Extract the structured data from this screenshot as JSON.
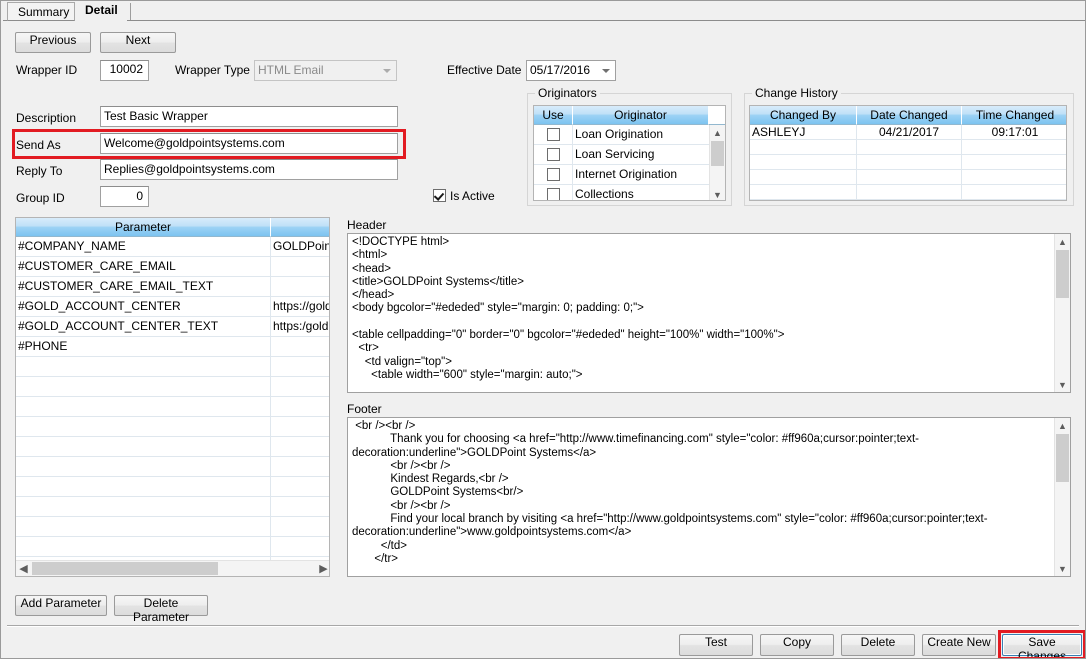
{
  "tabs": [
    {
      "label": "Summary",
      "active": false
    },
    {
      "label": "Detail",
      "active": true
    }
  ],
  "nav": {
    "previous_label": "Previous",
    "next_label": "Next"
  },
  "fields": {
    "wrapper_id_label": "Wrapper ID",
    "wrapper_id_value": "10002",
    "wrapper_type_label": "Wrapper Type",
    "wrapper_type_value": "HTML Email",
    "effective_date_label": "Effective Date",
    "effective_date_value": "05/17/2016",
    "description_label": "Description",
    "description_value": "Test Basic Wrapper",
    "send_as_label": "Send As",
    "send_as_value": "Welcome@goldpointsystems.com",
    "reply_to_label": "Reply To",
    "reply_to_value": "Replies@goldpointsystems.com",
    "group_id_label": "Group ID",
    "group_id_value": "0",
    "is_active_label": "Is Active",
    "is_active_checked": true
  },
  "originators": {
    "title": "Originators",
    "columns": [
      "Use",
      "Originator",
      ""
    ],
    "rows": [
      {
        "use": false,
        "name": "Loan Origination"
      },
      {
        "use": false,
        "name": "Loan Servicing"
      },
      {
        "use": false,
        "name": "Internet Origination"
      },
      {
        "use": false,
        "name": "Collections"
      }
    ]
  },
  "change_history": {
    "title": "Change History",
    "columns": [
      "Changed By",
      "Date Changed",
      "Time Changed"
    ],
    "rows": [
      {
        "changed_by": "ASHLEYJ",
        "date_changed": "04/21/2017",
        "time_changed": "09:17:01"
      },
      {
        "changed_by": "",
        "date_changed": "",
        "time_changed": ""
      },
      {
        "changed_by": "",
        "date_changed": "",
        "time_changed": ""
      },
      {
        "changed_by": "",
        "date_changed": "",
        "time_changed": ""
      },
      {
        "changed_by": "",
        "date_changed": "",
        "time_changed": ""
      }
    ]
  },
  "parameters": {
    "columns": [
      "Parameter",
      ""
    ],
    "rows": [
      {
        "parameter": "#COMPANY_NAME",
        "value": "GOLDPoint"
      },
      {
        "parameter": "#CUSTOMER_CARE_EMAIL",
        "value": ""
      },
      {
        "parameter": "#CUSTOMER_CARE_EMAIL_TEXT",
        "value": ""
      },
      {
        "parameter": "#GOLD_ACCOUNT_CENTER",
        "value": "https://gold"
      },
      {
        "parameter": "#GOLD_ACCOUNT_CENTER_TEXT",
        "value": "https:/goldp"
      },
      {
        "parameter": "#PHONE",
        "value": ""
      },
      {
        "parameter": "",
        "value": ""
      },
      {
        "parameter": "",
        "value": ""
      },
      {
        "parameter": "",
        "value": ""
      },
      {
        "parameter": "",
        "value": ""
      },
      {
        "parameter": "",
        "value": ""
      },
      {
        "parameter": "",
        "value": ""
      },
      {
        "parameter": "",
        "value": ""
      },
      {
        "parameter": "",
        "value": ""
      },
      {
        "parameter": "",
        "value": ""
      },
      {
        "parameter": "",
        "value": ""
      },
      {
        "parameter": "",
        "value": ""
      },
      {
        "parameter": "",
        "value": ""
      }
    ],
    "add_label": "Add Parameter",
    "delete_label": "Delete Parameter"
  },
  "header_section": {
    "label": "Header",
    "code": "<!DOCTYPE html>\n<html>\n<head>\n<title>GOLDPoint Systems</title>\n</head>\n<body bgcolor=\"#ededed\" style=\"margin: 0; padding: 0;\">\n\n<table cellpadding=\"0\" border=\"0\" bgcolor=\"#ededed\" height=\"100%\" width=\"100%\">\n  <tr>\n    <td valign=\"top\">\n      <table width=\"600\" style=\"margin: auto;\">"
  },
  "footer_section": {
    "label": "Footer",
    "code": " <br /><br />\n            Thank you for choosing <a href=\"http://www.timefinancing.com\" style=\"color: #ff960a;cursor:pointer;text-\ndecoration:underline\">GOLDPoint Systems</a>\n            <br /><br />\n            Kindest Regards,<br />\n            GOLDPoint Systems<br/>\n            <br /><br />\n            Find your local branch by visiting <a href=\"http://www.goldpointsystems.com\" style=\"color: #ff960a;cursor:pointer;text-\ndecoration:underline\">www.goldpointsystems.com</a>\n         </td>\n       </tr>"
  },
  "bottom_buttons": {
    "test_label": "Test",
    "copy_label": "Copy",
    "delete_label": "Delete",
    "create_new_label": "Create New",
    "save_changes_label": "Save Changes"
  },
  "colors": {
    "annotation": "#e21b22",
    "header_gradient_top": "#d8ecfb",
    "header_gradient_bottom": "#7cc3f0",
    "window_bg": "#f0f0f0"
  },
  "icons": {
    "scroll_up": "⌃",
    "scroll_down": "⌄",
    "scroll_left": "‹",
    "scroll_right": "›",
    "combo_arrow": "chevron-down-icon"
  }
}
